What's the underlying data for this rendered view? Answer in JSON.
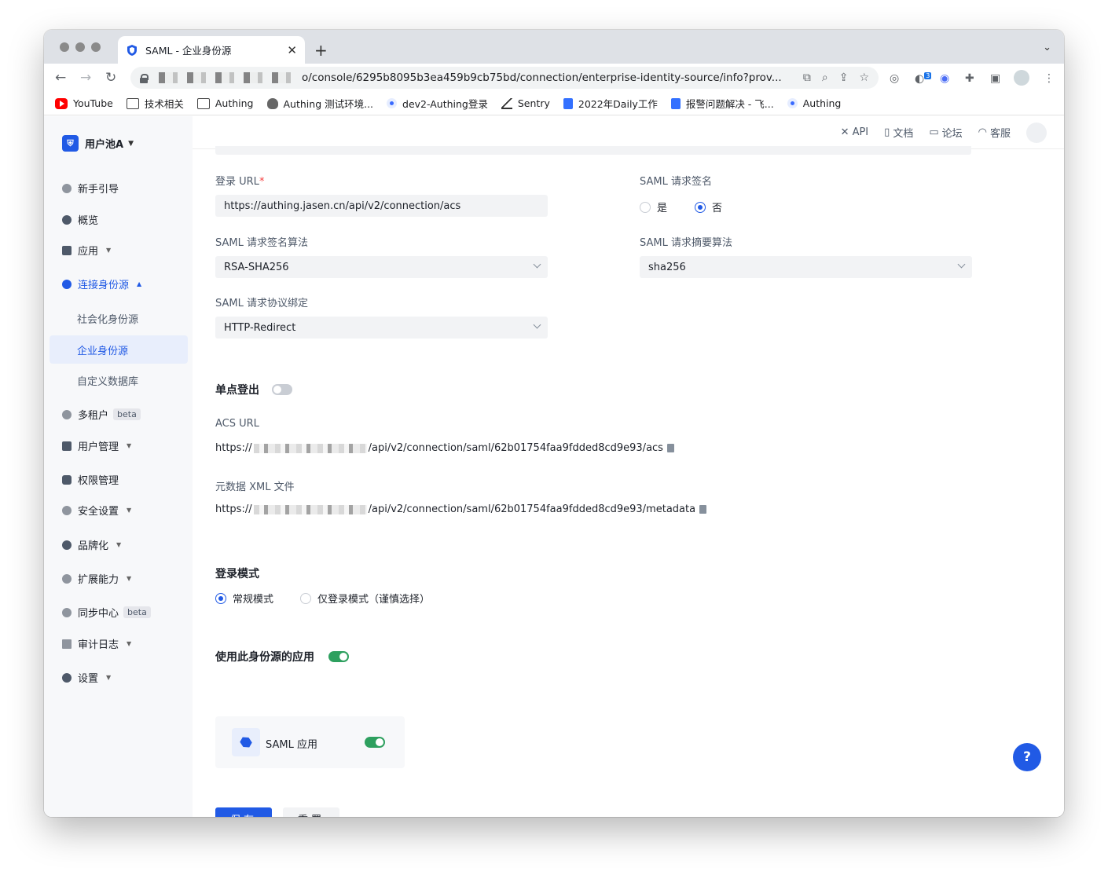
{
  "browser": {
    "tab_title": "SAML - 企业身份源",
    "new_tab": "+",
    "url": "o/console/6295b8095b3ea459b9cb75bd/connection/enterprise-identity-source/info?prov...",
    "bookmarks": [
      "YouTube",
      "技术相关",
      "Authing",
      "Authing 测试环境...",
      "dev2-Authing登录",
      "Sentry",
      "2022年Daily工作",
      "报警问题解决 - 飞...",
      "Authing"
    ],
    "extension_badge": "3"
  },
  "sidebar": {
    "pool_name": "用户池A",
    "items": [
      {
        "label": "新手引导"
      },
      {
        "label": "概览"
      },
      {
        "label": "应用"
      },
      {
        "label": "连接身份源"
      },
      {
        "label": "社会化身份源"
      },
      {
        "label": "企业身份源"
      },
      {
        "label": "自定义数据库"
      },
      {
        "label": "多租户",
        "badge": "beta"
      },
      {
        "label": "用户管理"
      },
      {
        "label": "权限管理"
      },
      {
        "label": "安全设置"
      },
      {
        "label": "品牌化"
      },
      {
        "label": "扩展能力"
      },
      {
        "label": "同步中心",
        "badge": "beta"
      },
      {
        "label": "审计日志"
      },
      {
        "label": "设置"
      }
    ]
  },
  "topbar": {
    "api": "API",
    "docs": "文档",
    "forum": "论坛",
    "support": "客服"
  },
  "form": {
    "login_url_label": "登录 URL",
    "login_url_required": "*",
    "login_url_value": "https://authing.jasen.cn/api/v2/connection/acs",
    "sign_request_label": "SAML 请求签名",
    "sign_yes": "是",
    "sign_no": "否",
    "sign_selected": "否",
    "sign_algo_label": "SAML 请求签名算法",
    "sign_algo_value": "RSA-SHA256",
    "digest_algo_label": "SAML 请求摘要算法",
    "digest_algo_value": "sha256",
    "binding_label": "SAML 请求协议绑定",
    "binding_value": "HTTP-Redirect",
    "slo_title": "单点登出",
    "slo_enabled": false,
    "acs_label": "ACS URL",
    "acs_prefix": "https://",
    "acs_suffix": "/api/v2/connection/saml/62b01754faa9fdded8cd9e93/acs",
    "metadata_label": "元数据 XML 文件",
    "metadata_prefix": "https://",
    "metadata_suffix": "/api/v2/connection/saml/62b01754faa9fdded8cd9e93/metadata",
    "login_mode_title": "登录模式",
    "mode_normal": "常规模式",
    "mode_login_only": "仅登录模式（谨慎选择）",
    "mode_selected": "常规模式",
    "apps_title": "使用此身份源的应用",
    "apps_enabled": true,
    "app_name": "SAML 应用",
    "app_enabled": true,
    "save": "保存",
    "reset": "重置"
  },
  "help_button": "?",
  "colors": {
    "primary": "#215ae5",
    "switch_on": "#2ea05f",
    "sidebar_bg": "#f7f8fa"
  }
}
